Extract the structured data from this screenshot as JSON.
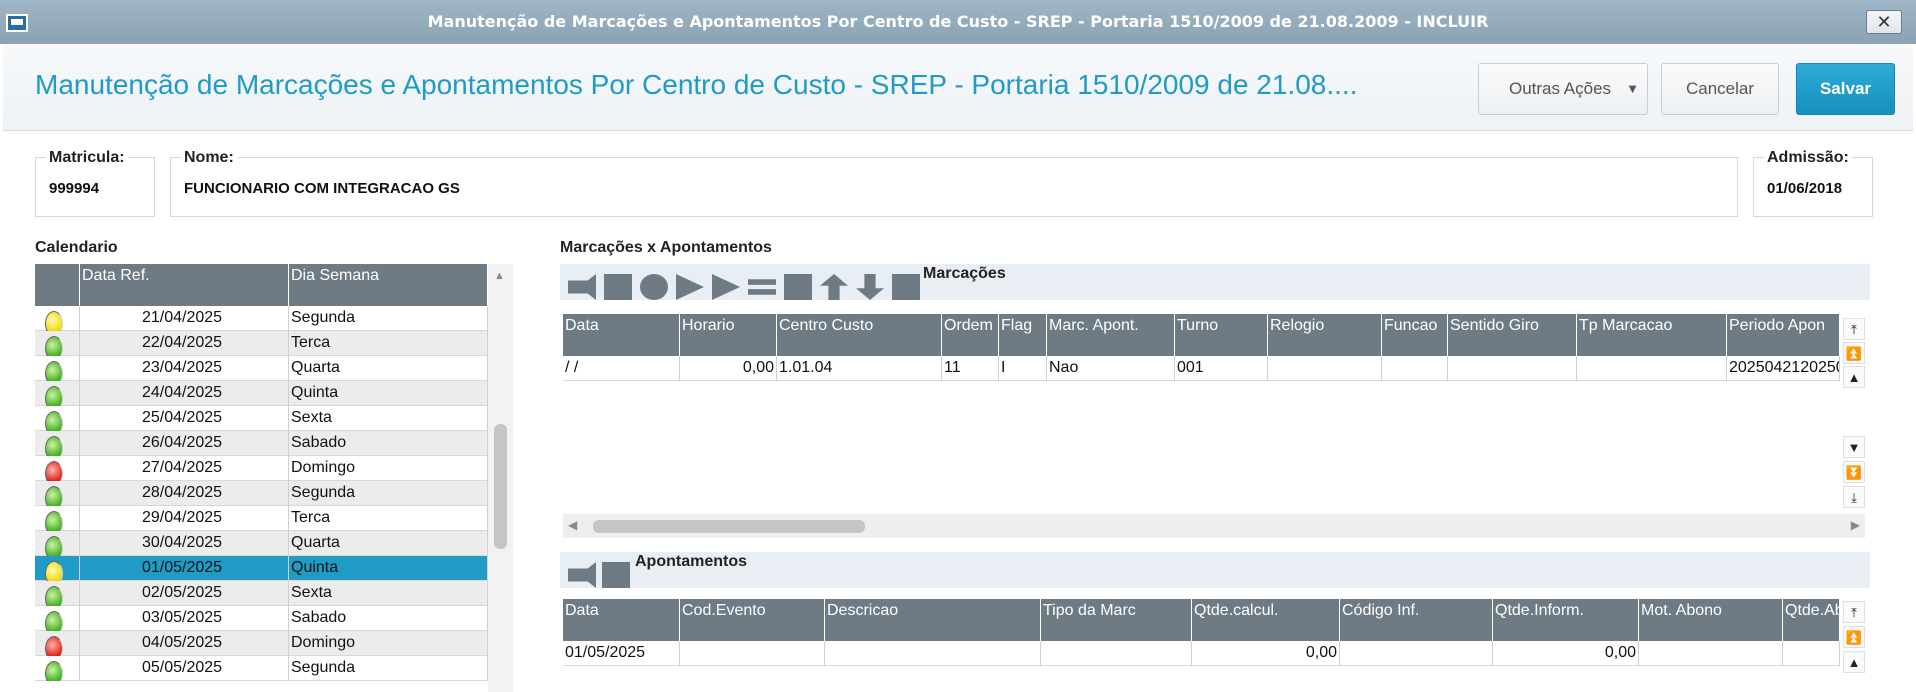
{
  "window": {
    "title": "Manutenção de Marcações e Apontamentos Por Centro de Custo - SREP - Portaria 1510/2009 de 21.08.2009 - INCLUIR",
    "close_label": "✕"
  },
  "header": {
    "title": "Manutenção de Marcações e Apontamentos Por Centro de Custo - SREP - Portaria 1510/2009 de 21.08....",
    "outras_label": "Outras Ações",
    "cancel_label": "Cancelar",
    "save_label": "Salvar"
  },
  "fields": {
    "matricula": {
      "label": "Matricula:",
      "value": "999994"
    },
    "nome": {
      "label": "Nome:",
      "value": "FUNCIONARIO COM INTEGRACAO GS"
    },
    "admissao": {
      "label": "Admissão:",
      "value": "01/06/2018"
    }
  },
  "calendario": {
    "label": "Calendario",
    "headers": [
      "",
      "Data Ref.",
      "Dia Semana"
    ],
    "rows": [
      {
        "status": "yellow",
        "date": "21/04/2025",
        "day": "Segunda"
      },
      {
        "status": "green",
        "date": "22/04/2025",
        "day": "Terca"
      },
      {
        "status": "green",
        "date": "23/04/2025",
        "day": "Quarta"
      },
      {
        "status": "green",
        "date": "24/04/2025",
        "day": "Quinta"
      },
      {
        "status": "green",
        "date": "25/04/2025",
        "day": "Sexta"
      },
      {
        "status": "green",
        "date": "26/04/2025",
        "day": "Sabado"
      },
      {
        "status": "red",
        "date": "27/04/2025",
        "day": "Domingo"
      },
      {
        "status": "green",
        "date": "28/04/2025",
        "day": "Segunda"
      },
      {
        "status": "green",
        "date": "29/04/2025",
        "day": "Terca"
      },
      {
        "status": "green",
        "date": "30/04/2025",
        "day": "Quarta"
      },
      {
        "status": "yellow",
        "date": "01/05/2025",
        "day": "Quinta",
        "selected": true
      },
      {
        "status": "green",
        "date": "02/05/2025",
        "day": "Sexta"
      },
      {
        "status": "green",
        "date": "03/05/2025",
        "day": "Sabado"
      },
      {
        "status": "red",
        "date": "04/05/2025",
        "day": "Domingo"
      },
      {
        "status": "green",
        "date": "05/05/2025",
        "day": "Segunda"
      }
    ]
  },
  "marcacoes_x": {
    "label": "Marcações x Apontamentos"
  },
  "marcacoes": {
    "label": "Marcações",
    "toolbar_icons": [
      "arrow-right-icon",
      "folder-icon",
      "circle-icon",
      "play-icon",
      "fast-forward-icon",
      "equals-icon",
      "clipboard-icon",
      "arrow-up-icon",
      "arrow-down-icon",
      "flag-icon"
    ],
    "headers": [
      "Data",
      "Horario",
      "Centro Custo",
      "Ordem",
      "Flag",
      "Marc. Apont.",
      "Turno",
      "Relogio",
      "Funcao",
      "Sentido Giro",
      "Tp Marcacao",
      "Periodo Apon"
    ],
    "rows": [
      [
        " /  /",
        "0,00",
        "1.01.04",
        "11",
        "I",
        "Nao",
        "001",
        "",
        "",
        "",
        "",
        "2025042120250"
      ]
    ]
  },
  "apontamentos": {
    "label": "Apontamentos",
    "toolbar_icons": [
      "arrow-right-icon",
      "flag-icon"
    ],
    "headers": [
      "Data",
      "Cod.Evento",
      "Descricao",
      "Tipo da Marc",
      "Qtde.calcul.",
      "Código Inf.",
      "Qtde.Inform.",
      "Mot. Abono",
      "Qtde.Ab"
    ],
    "rows": [
      [
        "01/05/2025",
        "",
        "",
        "",
        "0,00",
        "",
        "0,00",
        "",
        ""
      ]
    ]
  }
}
